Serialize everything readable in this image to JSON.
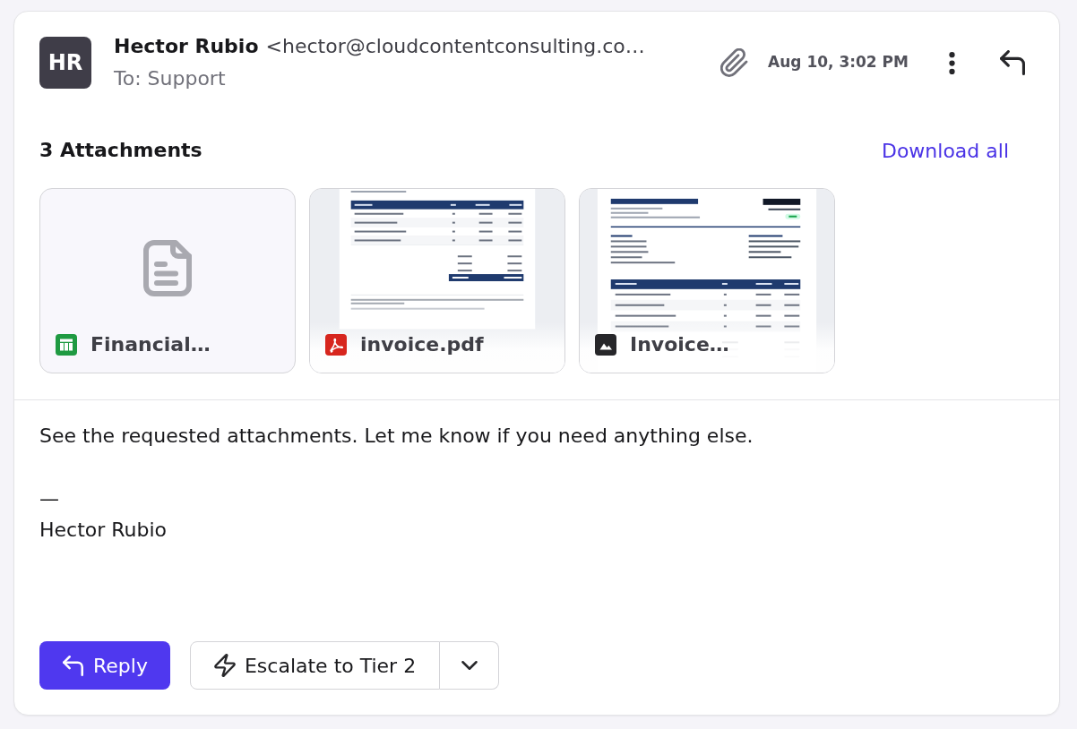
{
  "message": {
    "sender": {
      "initials": "HR",
      "name": "Hector Rubio",
      "email": "<hector@cloudcontentconsulting.co…"
    },
    "recipient": "To: Support",
    "timestamp": "Aug 10, 3:02 PM"
  },
  "attachments": {
    "title": "3 Attachments",
    "action": "Download all",
    "items": [
      {
        "name": "Financial…",
        "kind": "spreadsheet",
        "thumbnail": false
      },
      {
        "name": "invoice.pdf",
        "kind": "pdf",
        "thumbnail": true
      },
      {
        "name": "Invoice…",
        "kind": "image",
        "thumbnail": true
      }
    ]
  },
  "body": {
    "text": "See the requested attachments. Let me know if you need anything else.",
    "signature_rule": "—",
    "signature": "Hector Rubio"
  },
  "actions": [
    {
      "kind": "primary",
      "label": "Reply"
    },
    {
      "kind": "split",
      "label": "Escalate to Tier 2"
    }
  ]
}
